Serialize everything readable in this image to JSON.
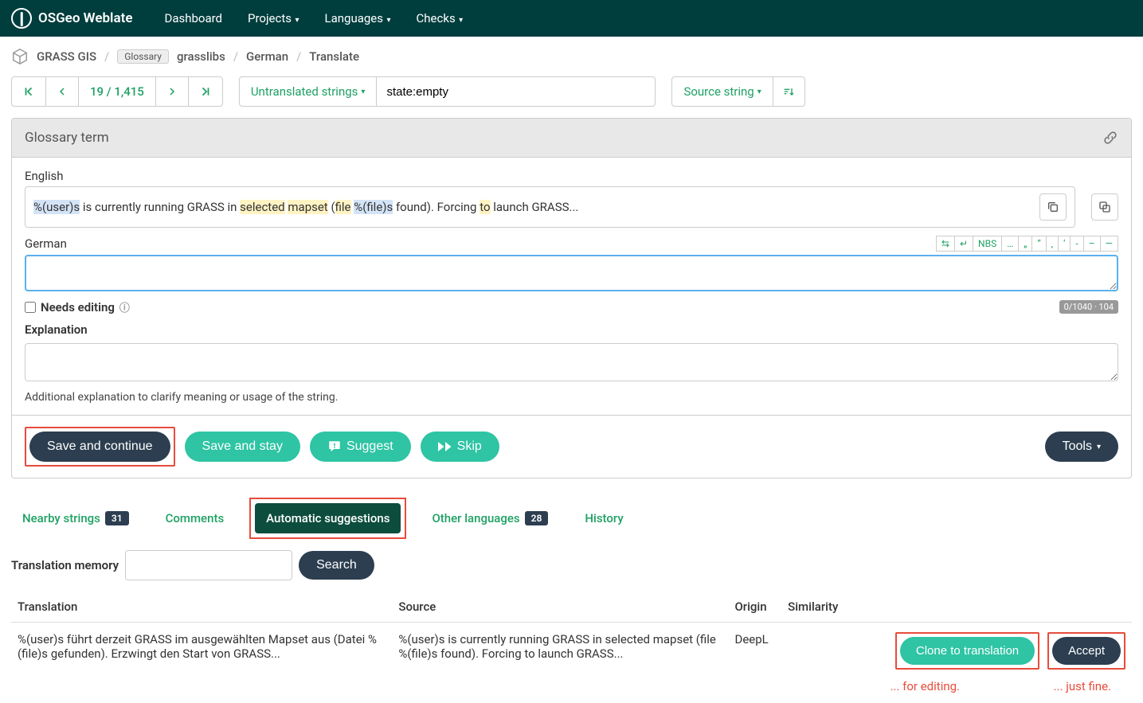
{
  "brand": "OSGeo Weblate",
  "nav": {
    "dashboard": "Dashboard",
    "projects": "Projects",
    "languages": "Languages",
    "checks": "Checks"
  },
  "breadcrumb": {
    "project": "GRASS GIS",
    "badge": "Glossary",
    "component": "grasslibs",
    "language": "German",
    "page": "Translate"
  },
  "position": "19 / 1,415",
  "filter": {
    "label": "Untranslated strings",
    "query": "state:empty"
  },
  "sort": "Source string",
  "panel": {
    "title": "Glossary term",
    "source_label": "English",
    "source_parts": {
      "p1": "%(user)s",
      "t1": " is currently running GRASS in ",
      "w1": "selected",
      "sp1": " ",
      "w2": "mapset",
      "t2": " (",
      "w3": "file",
      "sp2": " ",
      "p2": "%(file)s",
      "t3": " found). Forcing ",
      "w4": "to",
      "t4": " launch GRASS..."
    },
    "target_label": "German",
    "char_toolbar": [
      "⇆",
      "↵",
      "NBS",
      "…",
      "„",
      "“",
      "‚",
      "‘",
      "-",
      "–",
      "—"
    ],
    "needs_editing": "Needs editing",
    "counter": "0/1040 · 104",
    "explanation_label": "Explanation",
    "explanation_help": "Additional explanation to clarify meaning or usage of the string."
  },
  "actions": {
    "save_continue": "Save and continue",
    "save_stay": "Save and stay",
    "suggest": "Suggest",
    "skip": "Skip",
    "tools": "Tools"
  },
  "tabs": {
    "nearby": "Nearby strings",
    "nearby_count": "31",
    "comments": "Comments",
    "auto": "Automatic suggestions",
    "other": "Other languages",
    "other_count": "28",
    "history": "History"
  },
  "tm": {
    "label": "Translation memory",
    "search": "Search"
  },
  "sugg_headers": {
    "translation": "Translation",
    "source": "Source",
    "origin": "Origin",
    "similarity": "Similarity"
  },
  "suggestion": {
    "translation": "%(user)s führt derzeit GRASS im ausgewählten Mapset aus (Datei %(file)s gefunden). Erzwingt den Start von GRASS...",
    "source": "%(user)s is currently running GRASS in selected mapset (file %(file)s found). Forcing to launch GRASS...",
    "origin": "DeepL",
    "clone": "Clone to translation",
    "accept": "Accept"
  },
  "annotations": {
    "editing": "... for editing.",
    "fine": "... just fine."
  }
}
